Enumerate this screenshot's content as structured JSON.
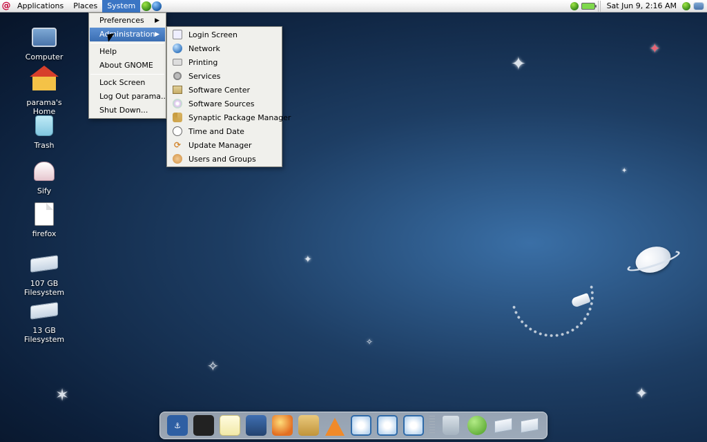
{
  "panel": {
    "menus": {
      "applications": "Applications",
      "places": "Places",
      "system": "System"
    },
    "clock": "Sat Jun  9,  2:16 AM"
  },
  "system_menu": {
    "preferences": "Preferences",
    "administration": "Administration",
    "help": "Help",
    "about": "About GNOME",
    "lock": "Lock Screen",
    "logout": "Log Out parama...",
    "shutdown": "Shut Down..."
  },
  "admin_submenu": {
    "login": "Login Screen",
    "network": "Network",
    "printing": "Printing",
    "services": "Services",
    "swcenter": "Software Center",
    "swsources": "Software Sources",
    "synaptic": "Synaptic Package Manager",
    "timedate": "Time and Date",
    "update": "Update Manager",
    "users": "Users and Groups"
  },
  "desktop": {
    "computer": "Computer",
    "home": "parama's Home",
    "trash": "Trash",
    "sify": "Sify",
    "firefox": "firefox",
    "fs107": "107 GB Filesystem",
    "fs13": "13 GB Filesystem"
  }
}
